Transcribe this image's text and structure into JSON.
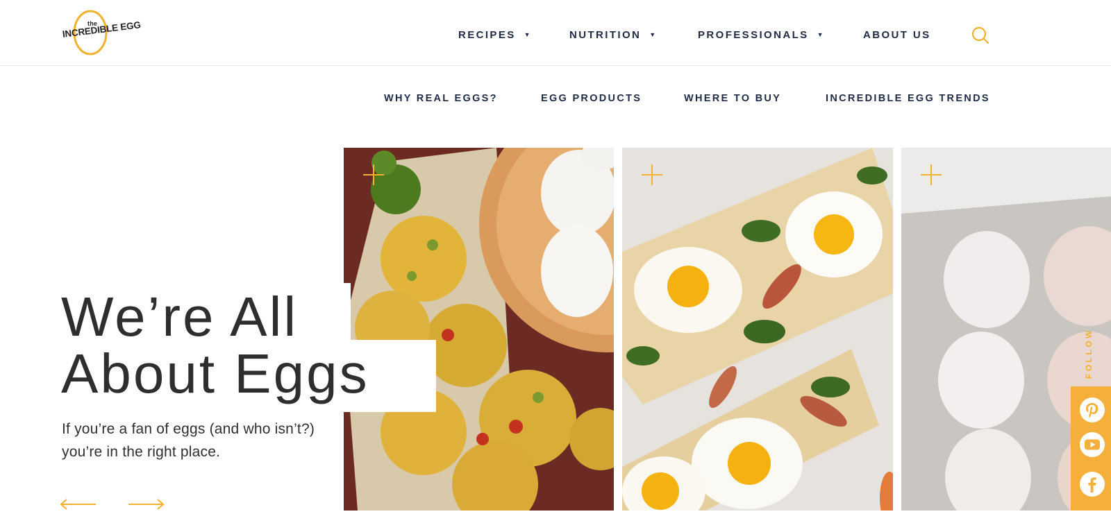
{
  "logo": {
    "the": "the",
    "brand": "INCREDIBLE EGG"
  },
  "main_nav": [
    {
      "label": "RECIPES",
      "has_dropdown": true
    },
    {
      "label": "NUTRITION",
      "has_dropdown": true
    },
    {
      "label": "PROFESSIONALS",
      "has_dropdown": true
    },
    {
      "label": "ABOUT US",
      "has_dropdown": false
    }
  ],
  "search": {
    "icon": "search-icon"
  },
  "sub_nav": [
    "WHY REAL EGGS?",
    "EGG PRODUCTS",
    "WHERE TO BUY",
    "INCREDIBLE EGG TRENDS"
  ],
  "hero": {
    "title_line1": "We’re All",
    "title_line2": "About Eggs",
    "subtitle": "If you’re a fan of eggs (and who isn’t?) you’re in the right place.",
    "prev_icon": "arrow-left-icon",
    "next_icon": "arrow-right-icon"
  },
  "cards": [
    {
      "icon": "plus-icon",
      "subject": "egg muffin cups with eggs in a wooden bowl"
    },
    {
      "icon": "plus-icon",
      "subject": "flatbread with sunny-side-up eggs, pear and spinach"
    },
    {
      "icon": "plus-icon",
      "subject": "eggs in a carton"
    }
  ],
  "follow": {
    "label": "FOLLOW",
    "networks": [
      {
        "name": "Pinterest",
        "icon": "pinterest-icon"
      },
      {
        "name": "YouTube",
        "icon": "youtube-icon"
      },
      {
        "name": "Facebook",
        "icon": "facebook-icon"
      }
    ]
  },
  "colors": {
    "accent": "#f2b12e",
    "nav_text": "#1f2a44",
    "heading": "#2e2e2e",
    "social_bar": "#f4b03b"
  }
}
